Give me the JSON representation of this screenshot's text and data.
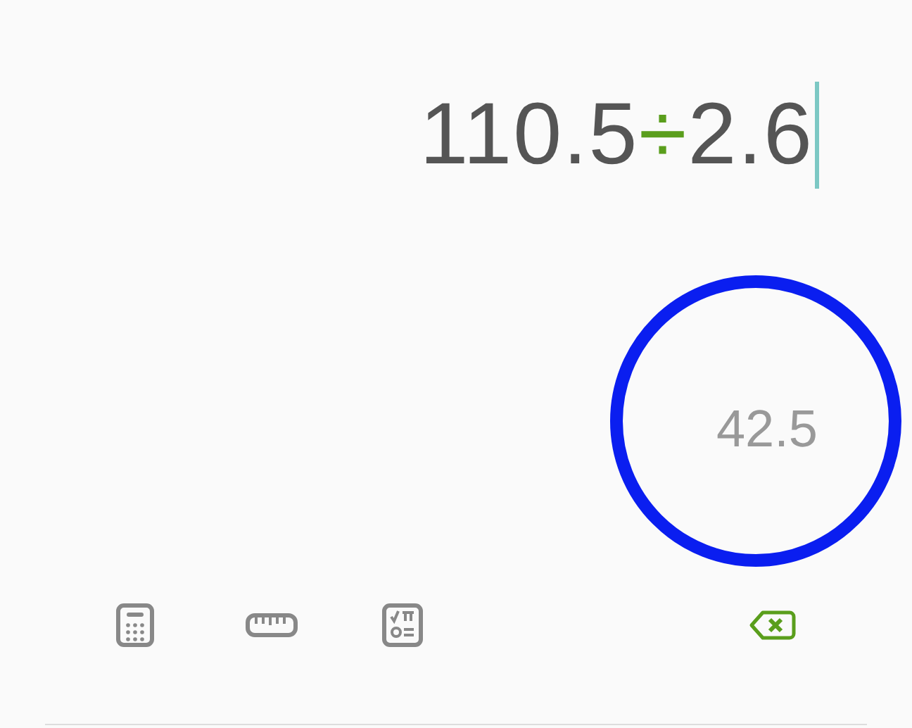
{
  "expression": [
    {
      "kind": "number",
      "text": "110.5"
    },
    {
      "kind": "operator",
      "text": "÷"
    },
    {
      "kind": "number",
      "text": "2.6"
    }
  ],
  "result": "42.5",
  "toolbar": [
    {
      "kind": "calculator"
    },
    {
      "kind": "ruler"
    },
    {
      "kind": "scientific"
    },
    {
      "kind": "backspace"
    }
  ]
}
